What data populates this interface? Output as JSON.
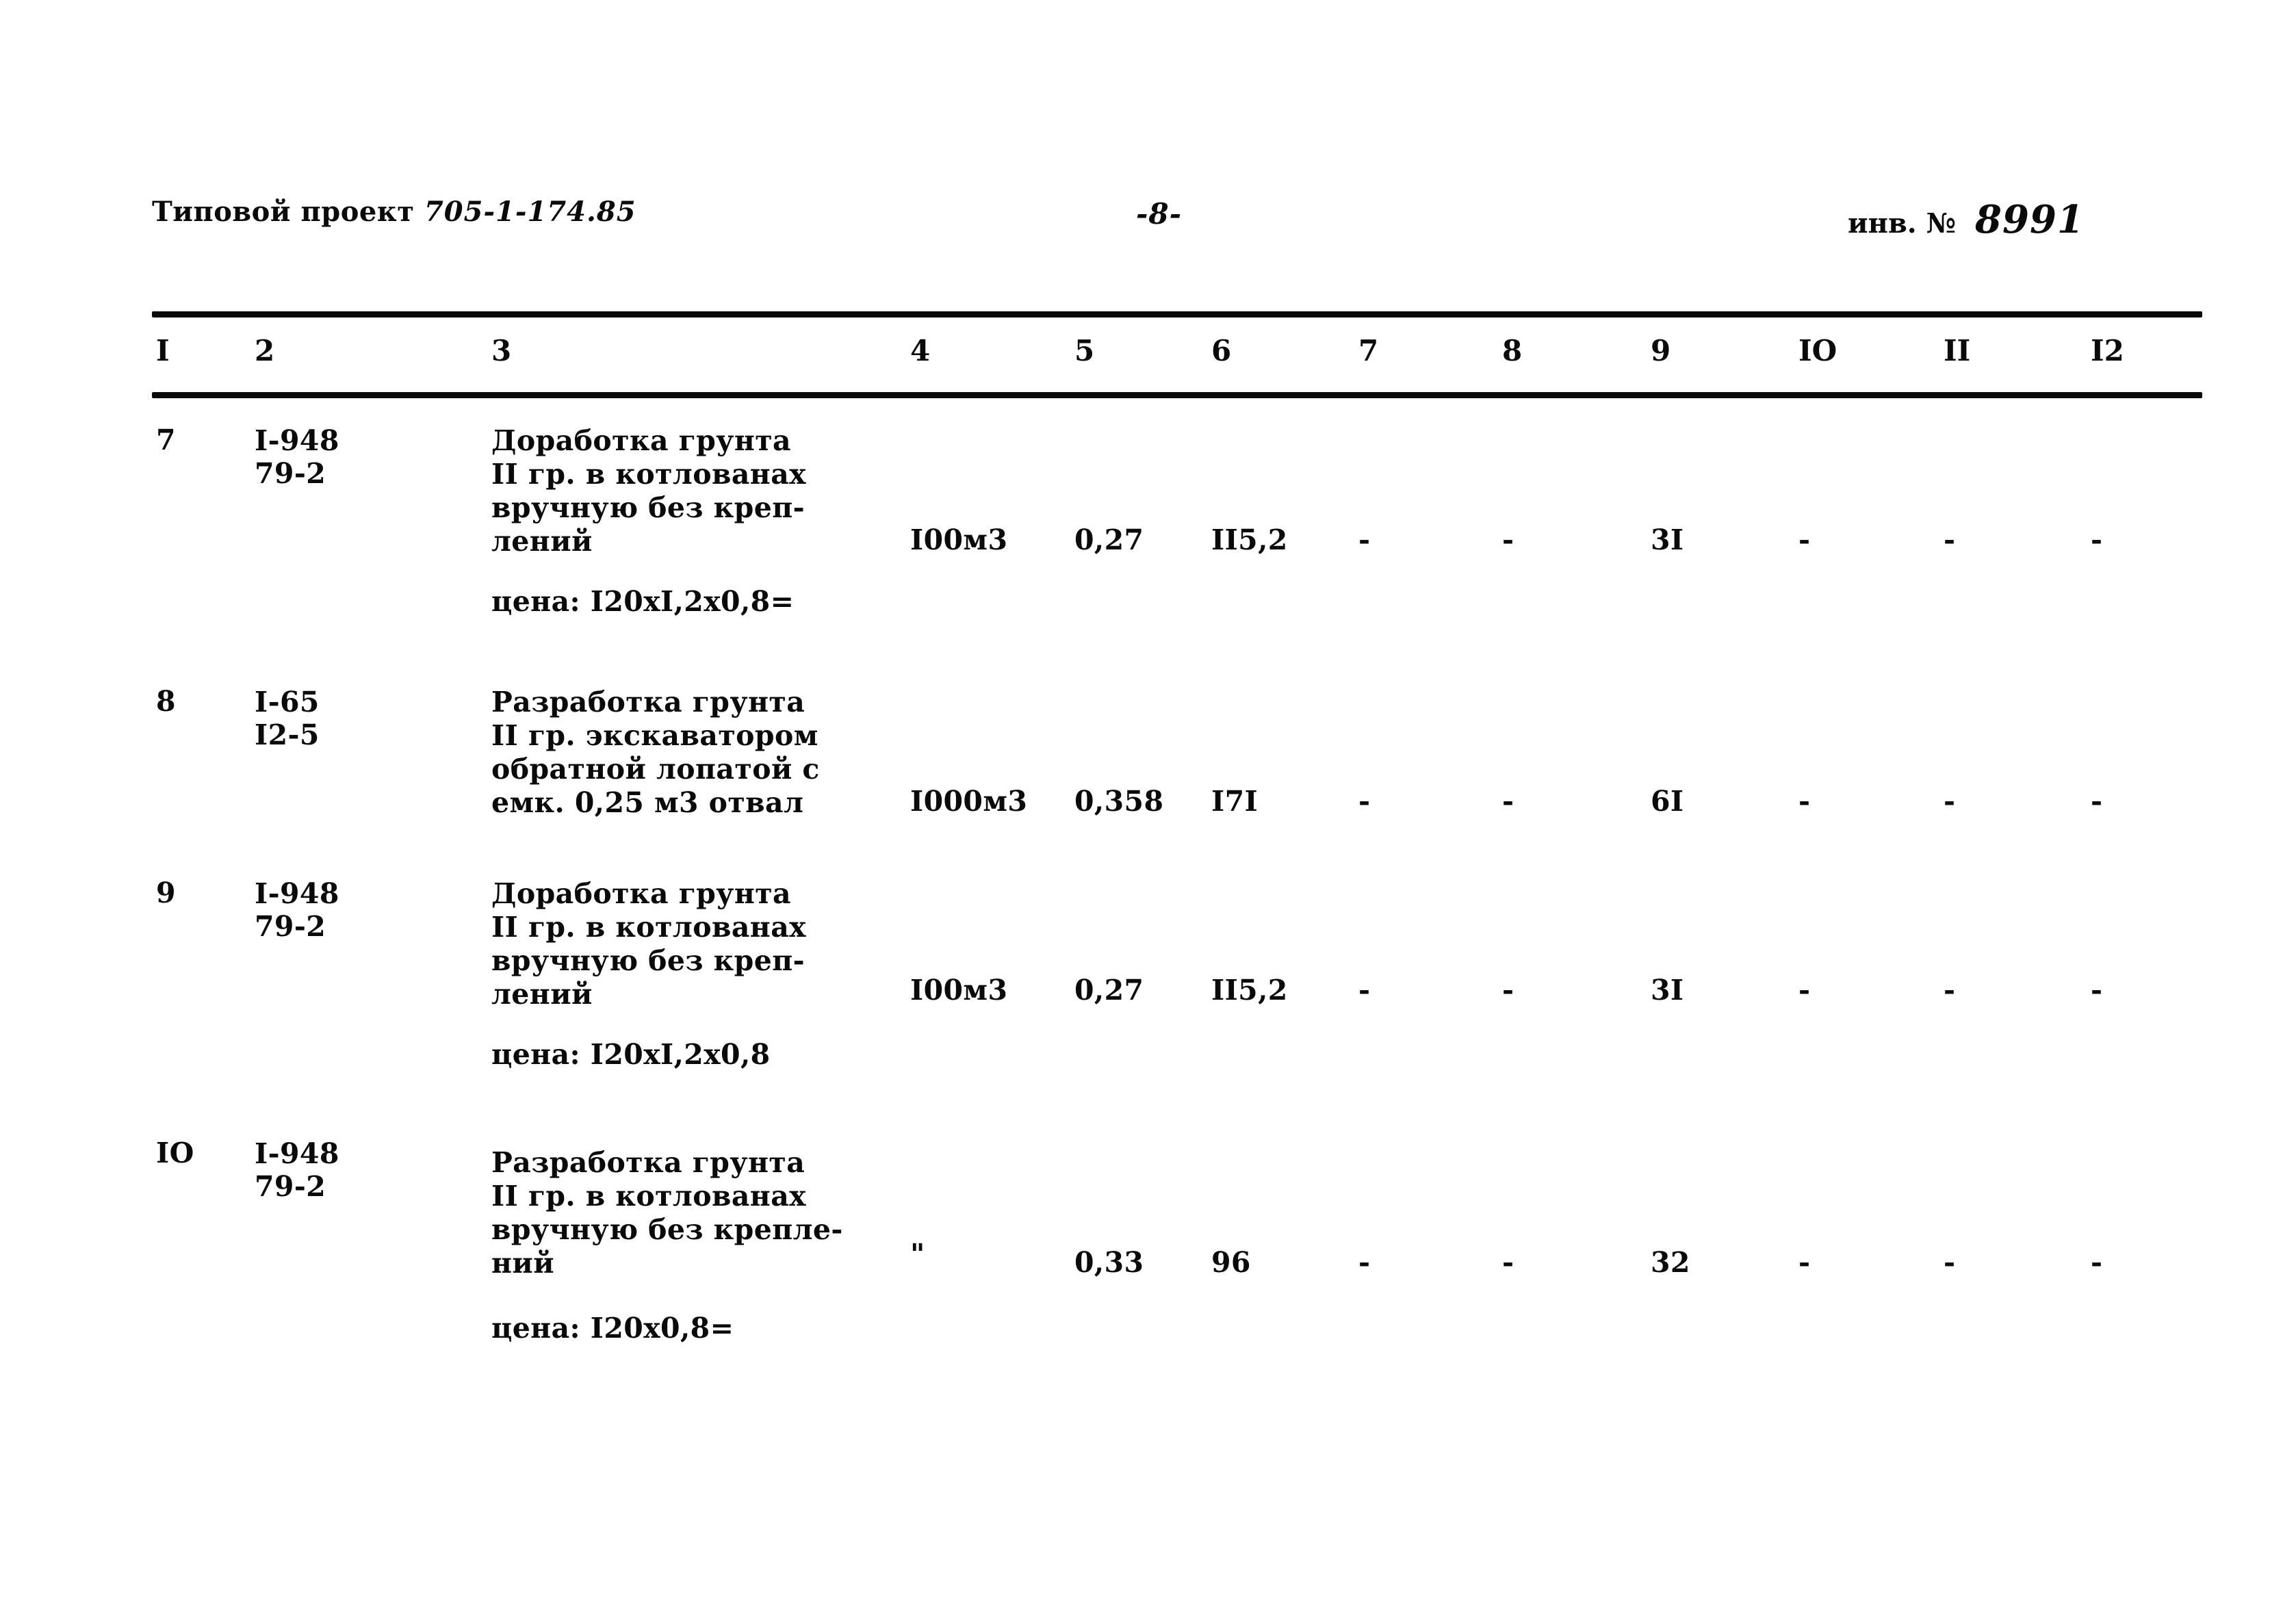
{
  "header": {
    "project_label": "Типовой проект",
    "project_number": "705-1-174.85",
    "page_number": "-8-",
    "inventory_label": "инв. №",
    "inventory_number": "8991"
  },
  "table": {
    "column_headers": [
      "I",
      "2",
      "3",
      "4",
      "5",
      "6",
      "7",
      "8",
      "9",
      "IO",
      "II",
      "I2"
    ],
    "rows": [
      {
        "no": "7",
        "code_line1": "I-948",
        "code_line2": "79-2",
        "description": "Доработка грунта\nII гр. в котлованах\nвручную без креп-\nлений",
        "price_note": "цена: I20xI,2x0,8=",
        "unit": "I00м3",
        "col5": "0,27",
        "col6": "II5,2",
        "col7": "-",
        "col8": "-",
        "col9": "3I",
        "col10": "-",
        "col11": "-",
        "col12": "-"
      },
      {
        "no": "8",
        "code_line1": "I-65",
        "code_line2": "I2-5",
        "description": "Разработка грунта\nII гр. экскаватором\nобратной лопатой с\nемк. 0,25 м3 отвал",
        "price_note": "",
        "unit": "I000м3",
        "col5": "0,358",
        "col6": "I7I",
        "col7": "-",
        "col8": "-",
        "col9": "6I",
        "col10": "-",
        "col11": "-",
        "col12": "-"
      },
      {
        "no": "9",
        "code_line1": "I-948",
        "code_line2": "79-2",
        "description": "Доработка грунта\nII гр. в котлованах\nвручную без креп-\nлений",
        "price_note": "цена: I20xI,2x0,8",
        "unit": "I00м3",
        "col5": "0,27",
        "col6": "II5,2",
        "col7": "-",
        "col8": "-",
        "col9": "3I",
        "col10": "-",
        "col11": "-",
        "col12": "-"
      },
      {
        "no": "IO",
        "code_line1": "I-948",
        "code_line2": "79-2",
        "description": "Разработка грунта\nII гр. в котлованах\nвручную без крепле-\nний",
        "price_note": "цена: I20x0,8=",
        "unit": "\"",
        "col5": "0,33",
        "col6": "96",
        "col7": "-",
        "col8": "-",
        "col9": "32",
        "col10": "-",
        "col11": "-",
        "col12": "-"
      }
    ]
  }
}
